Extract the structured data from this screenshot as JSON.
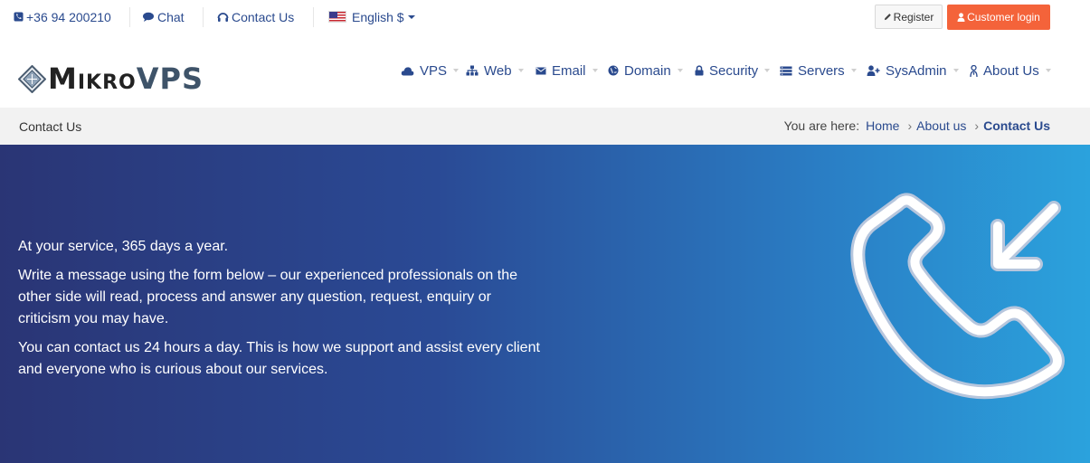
{
  "topbar": {
    "phone": "+36 94 200210",
    "chat": "Chat",
    "contact": "Contact Us",
    "language": "English $",
    "register": "Register",
    "login": "Customer login"
  },
  "logo": {
    "part1": "Mikro",
    "part2": "VPS"
  },
  "nav": [
    {
      "label": "VPS",
      "icon": "cloud-icon"
    },
    {
      "label": "Web",
      "icon": "sitemap-icon"
    },
    {
      "label": "Email",
      "icon": "envelope-icon"
    },
    {
      "label": "Domain",
      "icon": "globe-icon"
    },
    {
      "label": "Security",
      "icon": "lock-icon"
    },
    {
      "label": "Servers",
      "icon": "server-icon"
    },
    {
      "label": "SysAdmin",
      "icon": "user-plus-icon"
    },
    {
      "label": "About Us",
      "icon": "user-tie-icon"
    }
  ],
  "breadcrumb": {
    "title": "Contact Us",
    "prefix": "You are here:",
    "items": [
      "Home",
      "About us",
      "Contact Us"
    ]
  },
  "hero": {
    "p1": "At your service, 365 days a year.",
    "p2": "Write a message using the form below – our experienced professionals on the other side will read, process and answer any question, request, enquiry or criticism you may have.",
    "p3": "You can contact us 24 hours a day. This is how we support and assist every client and everyone who is curious about our services."
  },
  "colors": {
    "brand_blue": "#2a4a8e",
    "login_orange": "#f4633a",
    "hero_start": "#2a3575",
    "hero_end": "#2ba2dd"
  }
}
